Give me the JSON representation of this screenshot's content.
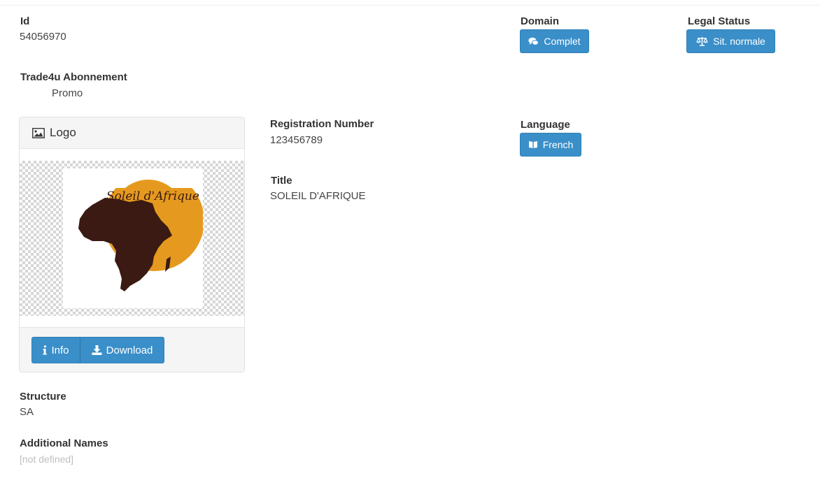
{
  "fields": {
    "id": {
      "label": "Id",
      "value": "54056970"
    },
    "subscription": {
      "label": "Trade4u Abonnement",
      "value": "Promo"
    },
    "domain": {
      "label": "Domain",
      "button": "Complet",
      "icon": "comments-icon"
    },
    "legal_status": {
      "label": "Legal Status",
      "button": "Sit. normale",
      "icon": "balance-scale-icon"
    },
    "registration": {
      "label": "Registration Number",
      "value": "123456789"
    },
    "title": {
      "label": "Title",
      "value": "SOLEIL D'AFRIQUE"
    },
    "language": {
      "label": "Language",
      "button": "French",
      "icon": "book-icon"
    },
    "structure": {
      "label": "Structure",
      "value": "SA"
    },
    "additional_names": {
      "label": "Additional Names",
      "value": "[not defined]"
    }
  },
  "logo_panel": {
    "title": "Logo",
    "title_icon": "image-icon",
    "logo_text": "Soleil d'Afrique",
    "info_button": "Info",
    "download_button": "Download"
  },
  "colors": {
    "button": "#3a8fc9",
    "logo_sun": "#e59a1f",
    "logo_africa": "#3a1a12"
  }
}
